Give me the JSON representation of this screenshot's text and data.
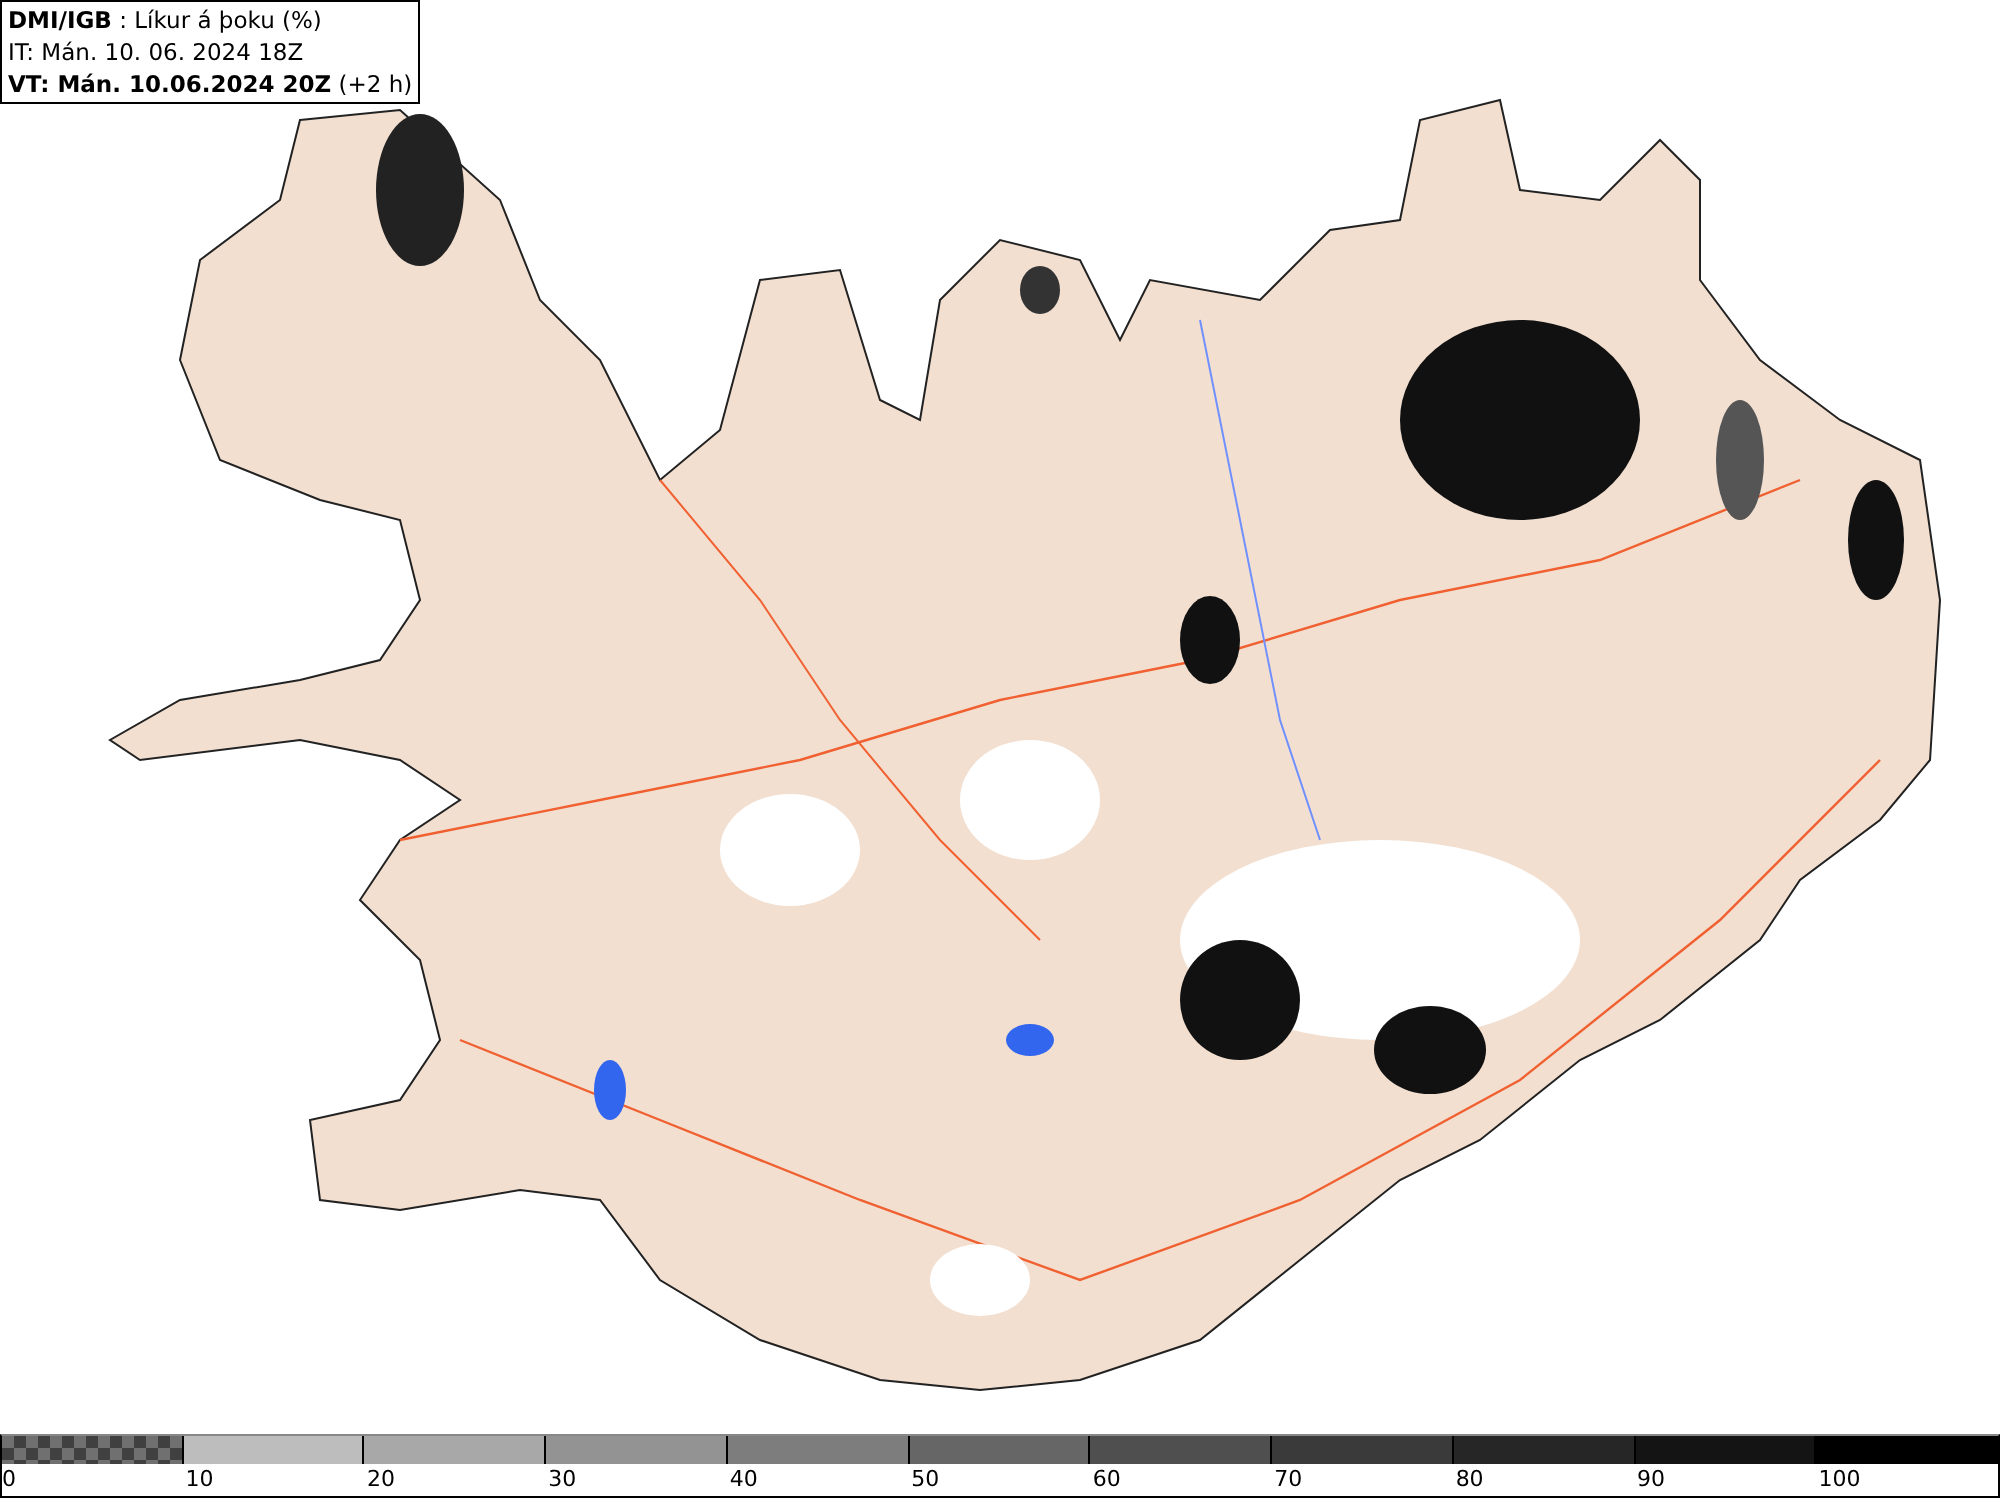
{
  "header": {
    "title": "**DMI/IGB** : Líkur á þoku (%)",
    "issue_time": "IT: Mán. 10. 06. 2024 18Z",
    "valid_time": "**VT: Mán. 10.06.2024 20Z** (+2 h)"
  },
  "legend": [
    {
      "kind": "checker",
      "color": "#707070",
      "label": "0"
    },
    {
      "kind": "solid",
      "color": "#bdbdbd",
      "label": "10"
    },
    {
      "kind": "solid",
      "color": "#a8a8a8",
      "label": "20"
    },
    {
      "kind": "solid",
      "color": "#939393",
      "label": "30"
    },
    {
      "kind": "solid",
      "color": "#7d7d7d",
      "label": "40"
    },
    {
      "kind": "solid",
      "color": "#666666",
      "label": "50"
    },
    {
      "kind": "solid",
      "color": "#4f4f4f",
      "label": "60"
    },
    {
      "kind": "solid",
      "color": "#3a3a3a",
      "label": "70"
    },
    {
      "kind": "solid",
      "color": "#262626",
      "label": "80"
    },
    {
      "kind": "solid",
      "color": "#141414",
      "label": "90"
    },
    {
      "kind": "solid",
      "color": "#000000",
      "label": "100"
    }
  ]
}
